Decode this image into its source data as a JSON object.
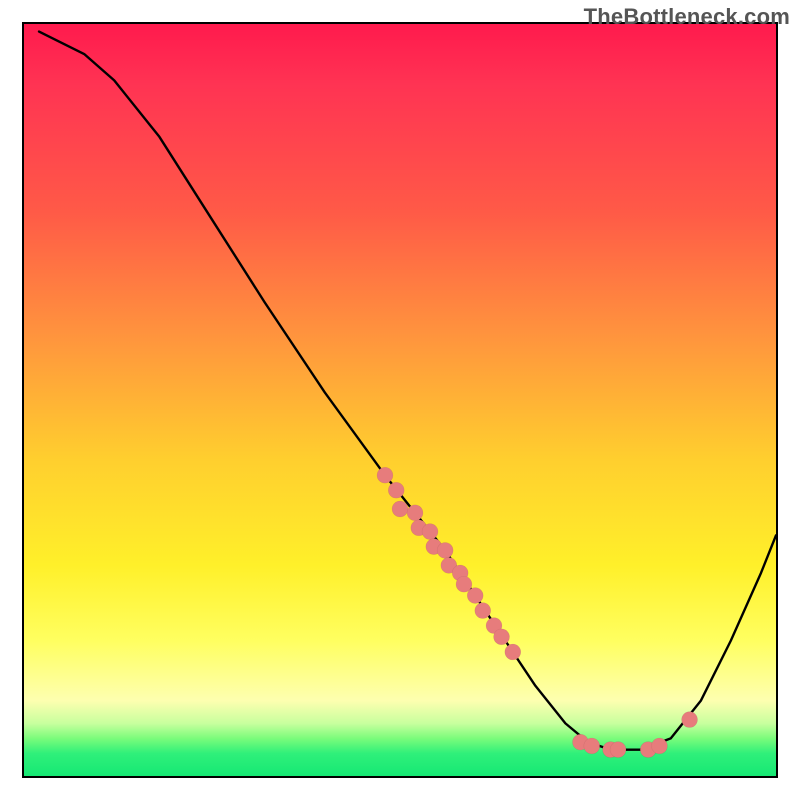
{
  "watermark": "TheBottleneck.com",
  "chart_data": {
    "type": "line",
    "title": "",
    "xlabel": "",
    "ylabel": "",
    "xlim": [
      0,
      100
    ],
    "ylim": [
      0,
      100
    ],
    "grid": false,
    "legend": false,
    "curve": [
      {
        "x": 2.0,
        "y": 99.0
      },
      {
        "x": 4.0,
        "y": 98.0
      },
      {
        "x": 8.0,
        "y": 96.0
      },
      {
        "x": 12.0,
        "y": 92.5
      },
      {
        "x": 18.0,
        "y": 85.0
      },
      {
        "x": 25.0,
        "y": 74.0
      },
      {
        "x": 32.0,
        "y": 63.0
      },
      {
        "x": 40.0,
        "y": 51.0
      },
      {
        "x": 48.0,
        "y": 40.0
      },
      {
        "x": 52.0,
        "y": 35.0
      },
      {
        "x": 56.0,
        "y": 30.0
      },
      {
        "x": 60.0,
        "y": 24.0
      },
      {
        "x": 64.0,
        "y": 18.0
      },
      {
        "x": 68.0,
        "y": 12.0
      },
      {
        "x": 72.0,
        "y": 7.0
      },
      {
        "x": 75.0,
        "y": 4.5
      },
      {
        "x": 78.0,
        "y": 3.5
      },
      {
        "x": 82.0,
        "y": 3.5
      },
      {
        "x": 86.0,
        "y": 5.0
      },
      {
        "x": 90.0,
        "y": 10.0
      },
      {
        "x": 94.0,
        "y": 18.0
      },
      {
        "x": 98.0,
        "y": 27.0
      },
      {
        "x": 100.0,
        "y": 32.0
      }
    ],
    "scatter_points": [
      {
        "x": 48.0,
        "y": 40.0
      },
      {
        "x": 49.5,
        "y": 38.0
      },
      {
        "x": 50.0,
        "y": 35.5
      },
      {
        "x": 52.0,
        "y": 35.0
      },
      {
        "x": 52.5,
        "y": 33.0
      },
      {
        "x": 54.0,
        "y": 32.5
      },
      {
        "x": 54.5,
        "y": 30.5
      },
      {
        "x": 56.0,
        "y": 30.0
      },
      {
        "x": 56.5,
        "y": 28.0
      },
      {
        "x": 58.0,
        "y": 27.0
      },
      {
        "x": 58.5,
        "y": 25.5
      },
      {
        "x": 60.0,
        "y": 24.0
      },
      {
        "x": 61.0,
        "y": 22.0
      },
      {
        "x": 62.5,
        "y": 20.0
      },
      {
        "x": 63.5,
        "y": 18.5
      },
      {
        "x": 65.0,
        "y": 16.5
      },
      {
        "x": 74.0,
        "y": 4.5
      },
      {
        "x": 75.5,
        "y": 4.0
      },
      {
        "x": 78.0,
        "y": 3.5
      },
      {
        "x": 79.0,
        "y": 3.5
      },
      {
        "x": 83.0,
        "y": 3.5
      },
      {
        "x": 84.5,
        "y": 4.0
      },
      {
        "x": 88.5,
        "y": 7.5
      }
    ],
    "gradient_stops": [
      {
        "pos": 0.0,
        "color": "#ff1a4d"
      },
      {
        "pos": 0.25,
        "color": "#ff5a47"
      },
      {
        "pos": 0.58,
        "color": "#ffcf2e"
      },
      {
        "pos": 0.82,
        "color": "#ffff60"
      },
      {
        "pos": 0.95,
        "color": "#7bfc7b"
      },
      {
        "pos": 1.0,
        "color": "#16e874"
      }
    ]
  }
}
